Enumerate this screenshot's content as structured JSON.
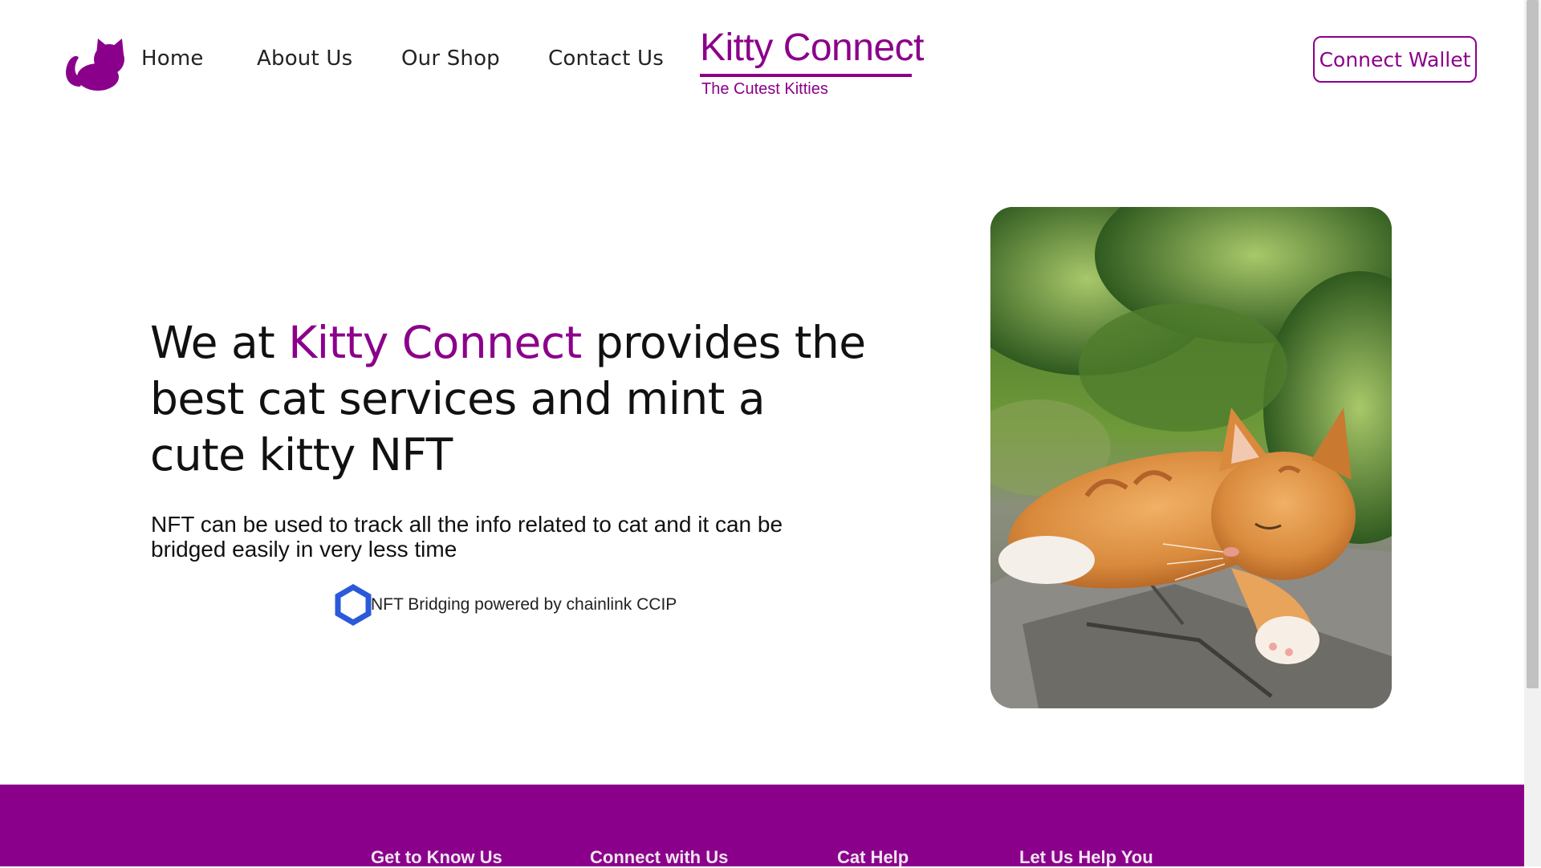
{
  "header": {
    "logo_icon": "cat-silhouette-icon",
    "nav": [
      "Home",
      "About Us",
      "Our Shop",
      "Contact Us"
    ],
    "brand_title": "Kitty Connect",
    "brand_subtitle": "The Cutest Kitties",
    "wallet_button": "Connect Wallet"
  },
  "hero": {
    "title_pre": "We at ",
    "title_accent": "Kitty Connect",
    "title_post": " provides the best cat services and mint a cute kitty NFT",
    "subtitle": "NFT can be used to track all the info related to cat and it can be bridged easily in very less time",
    "powered_icon": "chainlink-hexagon-icon",
    "powered_text": "NFT Bridging powered by chainlink CCIP",
    "image_icon": "sleeping-orange-cat-photo"
  },
  "footer": {
    "headings": [
      "Get to Know Us",
      "Connect with Us",
      "Cat Help",
      "Let Us Help You"
    ]
  },
  "colors": {
    "accent": "#8b008b",
    "chainlink_blue": "#2a5ada",
    "text": "#111111"
  }
}
